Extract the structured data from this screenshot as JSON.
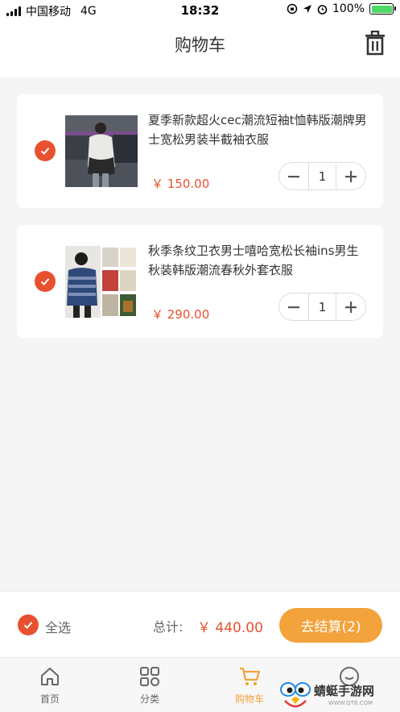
{
  "status_bar": {
    "carrier": "中国移动",
    "network": "4G",
    "time": "18:32",
    "battery": "100%",
    "battery_level": 1.0
  },
  "nav": {
    "title": "购物车",
    "delete_icon": "trash-icon"
  },
  "cart_items": [
    {
      "title": "夏季新款超火cec潮流短袖t恤韩版潮牌男士宽松男装半截袖衣服",
      "price": "￥ 150.00",
      "quantity": "1",
      "selected": true
    },
    {
      "title": "秋季条纹卫衣男士嘻哈宽松长袖ins男生秋装韩版潮流春秋外套衣服",
      "price": "￥ 290.00",
      "quantity": "1",
      "selected": true
    }
  ],
  "checkout": {
    "select_all_label": "全选",
    "total_label": "总计:",
    "total_value": "￥ 440.00",
    "pay_button": "去结算(2)"
  },
  "tabs": [
    {
      "label": "首页",
      "icon": "home-icon"
    },
    {
      "label": "分类",
      "icon": "category-grid-icon"
    },
    {
      "label": "购物车",
      "icon": "cart-icon",
      "active": true
    },
    {
      "label": "",
      "icon": "profile-icon"
    }
  ],
  "watermark": {
    "text": "蜻蜓手游网",
    "url": "WWW.QT6.COM"
  },
  "colors": {
    "accent": "#e8512f",
    "button": "#f3a23c",
    "background": "#f5f5f5"
  }
}
